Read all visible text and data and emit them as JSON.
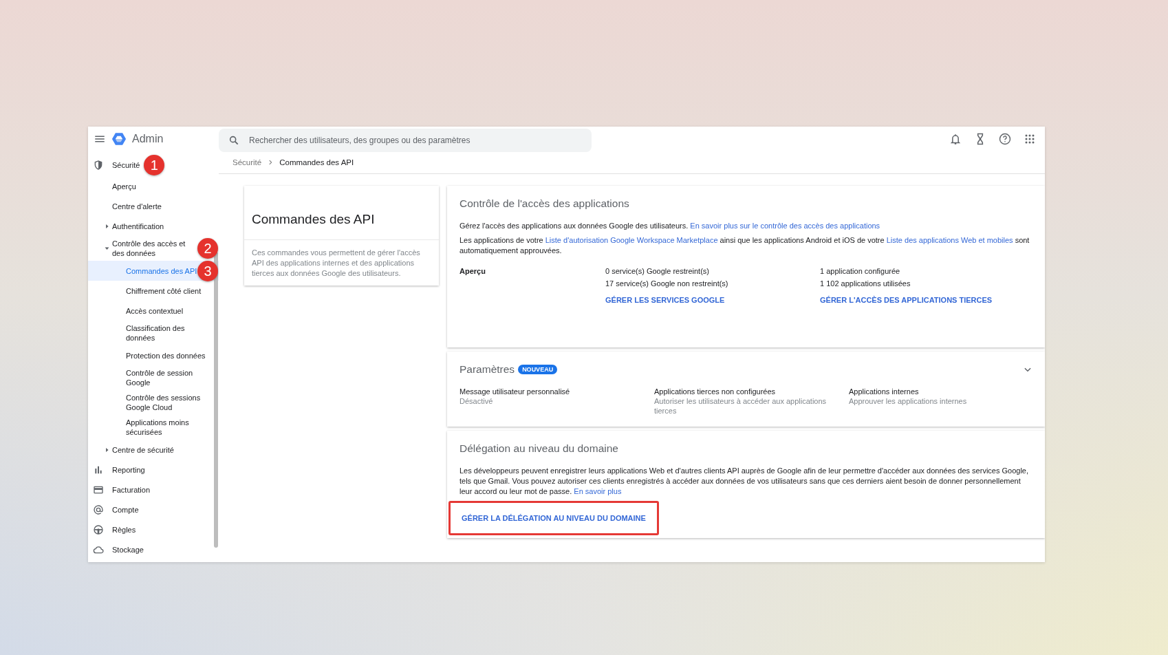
{
  "topbar": {
    "app_name": "Admin",
    "search": {
      "placeholder": "Rechercher des utilisateurs, des groupes ou des paramètres"
    }
  },
  "sidebar": {
    "items": [
      {
        "label": "Sécurité",
        "selected": false,
        "marker": "1",
        "children": [
          {
            "label": "Aperçu",
            "selected": false
          },
          {
            "label": "Centre d'alerte",
            "selected": false
          },
          {
            "label": "Authentification",
            "selected": false,
            "expanded": false
          },
          {
            "label": "Contrôle des accès et des données",
            "selected": false,
            "expanded": true,
            "marker": "2",
            "children": [
              {
                "label": "Commandes des API",
                "selected": true,
                "marker": "3"
              },
              {
                "label": "Chiffrement côté client",
                "selected": false
              },
              {
                "label": "Accès contextuel",
                "selected": false
              },
              {
                "label": "Classification des données",
                "selected": false
              },
              {
                "label": "Protection des données",
                "selected": false
              },
              {
                "label": "Contrôle de session Google",
                "selected": false
              },
              {
                "label": "Contrôle des sessions Google Cloud",
                "selected": false
              },
              {
                "label": "Applications moins sécurisées",
                "selected": false
              }
            ]
          },
          {
            "label": "Centre de sécurité",
            "selected": false,
            "expanded": false
          }
        ]
      },
      {
        "label": "Reporting",
        "selected": false
      },
      {
        "label": "Facturation",
        "selected": false
      },
      {
        "label": "Compte",
        "selected": false
      },
      {
        "label": "Règles",
        "selected": false
      },
      {
        "label": "Stockage",
        "selected": false
      }
    ]
  },
  "breadcrumb": [
    {
      "label": "Sécurité",
      "current": false
    },
    {
      "label": "Commandes des API",
      "current": true
    }
  ],
  "intro_card": {
    "title": "Commandes des API",
    "description": "Ces commandes vous permettent de gérer l'accès API des applications internes et des applications tierces aux données Google des utilisateurs."
  },
  "sections": [
    {
      "kind": "overview",
      "title": "Contrôle de l'accès des applications",
      "paragraphs": [
        [
          {
            "kind": "text",
            "text": "Gérez l'accès des applications aux données Google des utilisateurs."
          },
          {
            "kind": "link",
            "text": "En savoir plus sur le contrôle des accès des applications"
          }
        ],
        [
          {
            "kind": "text",
            "text": "Les applications de votre"
          },
          {
            "kind": "link",
            "text": "Liste d'autorisation Google Workspace Marketplace"
          },
          {
            "kind": "text",
            "text": "ainsi que les applications Android et iOS de votre"
          },
          {
            "kind": "link",
            "text": "Liste des applications Web et mobiles"
          },
          {
            "kind": "text",
            "text": "sont automatiquement approuvées."
          }
        ]
      ],
      "overview": {
        "label": "Aperçu",
        "columns": [
          {
            "lines": [
              "0 service(s) Google restreint(s)",
              "17 service(s) Google non restreint(s)"
            ],
            "action": "GÉRER LES SERVICES GOOGLE"
          },
          {
            "lines": [
              "1 application configurée",
              "1 102 applications utilisées"
            ],
            "action": "GÉRER L'ACCÈS DES APPLICATIONS TIERCES"
          }
        ]
      }
    },
    {
      "kind": "settings",
      "title": "Paramètres",
      "badge": "NOUVEAU",
      "expanded": false,
      "settings": [
        {
          "name": "Message utilisateur personnalisé",
          "value": "Désactivé"
        },
        {
          "name": "Applications tierces non configurées",
          "value": "Autoriser les utilisateurs à accéder aux applications tierces"
        },
        {
          "name": "Applications internes",
          "value": "Approuver les applications internes"
        }
      ]
    },
    {
      "kind": "delegation",
      "title": "Délégation au niveau du domaine",
      "paragraphs": [
        [
          {
            "kind": "text",
            "text": "Les développeurs peuvent enregistrer leurs applications Web et d'autres clients API auprès de Google afin de leur permettre d'accéder aux données des services Google, tels que Gmail. Vous pouvez autoriser ces clients enregistrés à accéder aux données de vos utilisateurs sans que ces derniers aient besoin de donner personnellement leur accord ou leur mot de passe."
          },
          {
            "kind": "link",
            "text": "En savoir plus"
          }
        ]
      ],
      "action": {
        "label": "GÉRER LA DÉLÉGATION AU NIVEAU DU DOMAINE",
        "highlighted": true
      }
    }
  ]
}
